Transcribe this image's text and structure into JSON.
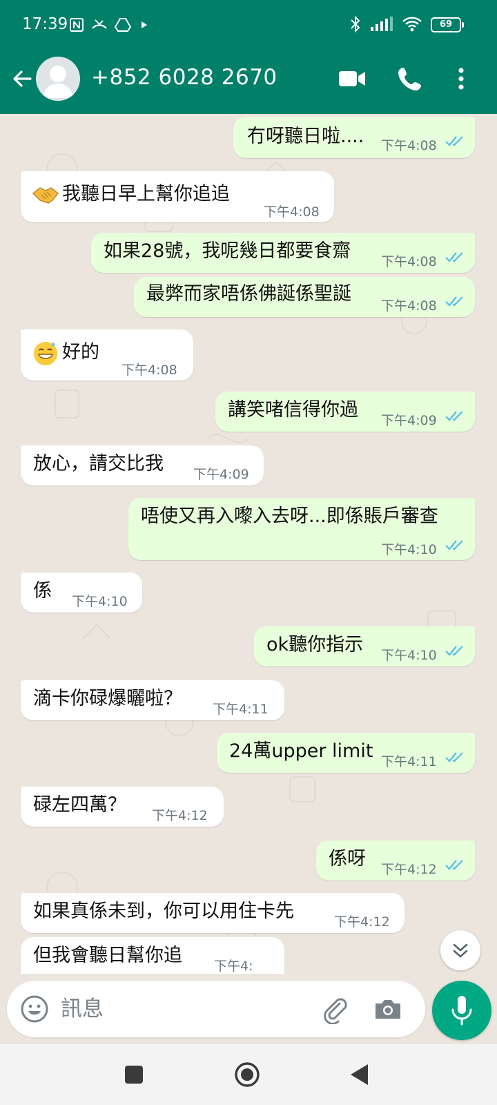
{
  "status_bar": {
    "time": "17:39",
    "battery": "69"
  },
  "header": {
    "contact_name": "+852 6028 2670",
    "icons": [
      "back-arrow-icon",
      "avatar",
      "video-call-icon",
      "voice-call-icon",
      "more-vert-icon"
    ]
  },
  "messages": [
    {
      "dir": "out",
      "text": "冇呀聽日啦....",
      "time": "下午4:08",
      "read": true
    },
    {
      "dir": "in",
      "emoji": "handshake",
      "text": "我聽日早上幫你追追",
      "time": "下午4:08"
    },
    {
      "dir": "out",
      "text": "如果28號，我呢幾日都要食齋",
      "time": "下午4:08",
      "read": true
    },
    {
      "dir": "out",
      "text": "最弊而家唔係佛誕係聖誕",
      "time": "下午4:08",
      "read": true
    },
    {
      "dir": "in",
      "emoji": "grinning-sweat",
      "text": "好的",
      "time": "下午4:08"
    },
    {
      "dir": "out",
      "text": "講笑啫信得你過",
      "time": "下午4:09",
      "read": true
    },
    {
      "dir": "in",
      "text": "放心，請交比我",
      "time": "下午4:09"
    },
    {
      "dir": "out",
      "text": "唔使又再入嚟入去呀...即係賬戶審查",
      "time": "下午4:10",
      "read": true
    },
    {
      "dir": "in",
      "text": "係",
      "time": "下午4:10"
    },
    {
      "dir": "out",
      "text": "ok聽你指示",
      "time": "下午4:10",
      "read": true
    },
    {
      "dir": "in",
      "text": "滴卡你碌爆曬啦？",
      "time": "下午4:11"
    },
    {
      "dir": "out",
      "text": "24萬upper limit",
      "time": "下午4:11",
      "read": true
    },
    {
      "dir": "in",
      "text": "碌左四萬？",
      "time": "下午4:12"
    },
    {
      "dir": "out",
      "text": "係呀",
      "time": "下午4:12",
      "read": true
    },
    {
      "dir": "in",
      "text": "如果真係未到，你可以用住卡先",
      "time": "下午4:12"
    },
    {
      "dir": "in",
      "text": "但我會聽日幫你追",
      "time": "下午4:"
    }
  ],
  "composer": {
    "placeholder": "訊息",
    "icons": [
      "emoji-icon",
      "attach-icon",
      "camera-icon",
      "mic-icon"
    ]
  },
  "colors": {
    "header": "#008069",
    "outgoing": "#e7ffdb",
    "incoming": "#ffffff",
    "background": "#ece5dd",
    "ticks": "#53bdeb",
    "mic": "#00a884"
  }
}
